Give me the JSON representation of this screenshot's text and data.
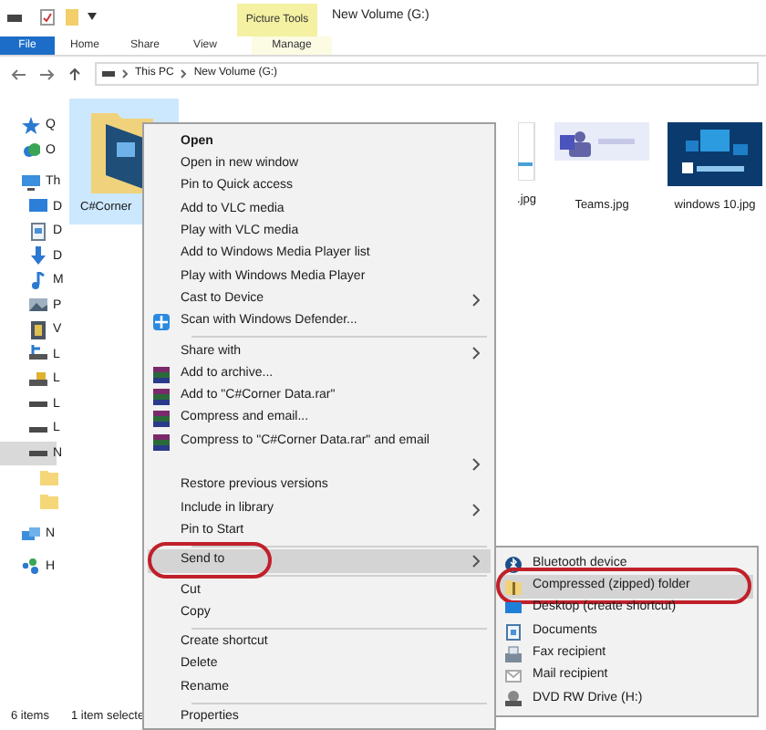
{
  "window": {
    "title": "New Volume (G:)",
    "context_tab": "Picture Tools"
  },
  "ribbon_tabs": [
    {
      "label": "File",
      "kind": "file"
    },
    {
      "label": "Home",
      "kind": "tab"
    },
    {
      "label": "Share",
      "kind": "tab"
    },
    {
      "label": "View",
      "kind": "tab"
    },
    {
      "label": "Manage",
      "kind": "context"
    }
  ],
  "address_bar": {
    "path": [
      "This PC",
      "New Volume (G:)"
    ]
  },
  "nav_pane": [
    {
      "label": "Q",
      "selected": false
    },
    {
      "label": "O",
      "selected": false
    },
    {
      "label": "Th",
      "selected": false,
      "children": [
        {
          "label": "D",
          "selected": false
        },
        {
          "label": "D",
          "selected": false
        },
        {
          "label": "D",
          "selected": false
        },
        {
          "label": "M",
          "selected": false
        },
        {
          "label": "P",
          "selected": false
        },
        {
          "label": "V",
          "selected": false
        },
        {
          "label": "L",
          "selected": false
        },
        {
          "label": "L",
          "selected": false
        },
        {
          "label": "L",
          "selected": false
        },
        {
          "label": "L",
          "selected": false
        },
        {
          "label": "N",
          "selected": true,
          "children": [
            {
              "selected": false
            },
            {
              "selected": false
            }
          ]
        }
      ]
    },
    {
      "label": "N",
      "selected": false
    },
    {
      "label": "H",
      "selected": false
    }
  ],
  "files": [
    {
      "name": "C#Corner",
      "kind": "folder",
      "selected": true
    },
    {
      "name": ".jpg",
      "kind": "partial",
      "selected": false
    },
    {
      "name": "Teams.jpg",
      "kind": "picture",
      "selected": false
    },
    {
      "name": "windows 10.jpg",
      "kind": "picture",
      "selected": false
    }
  ],
  "context_menu": [
    {
      "kind": "plain",
      "label": "Open",
      "bold": true,
      "selected": false
    },
    {
      "kind": "plain",
      "label": "Open in new window",
      "selected": false
    },
    {
      "kind": "plain",
      "label": "Pin to Quick access",
      "selected": false
    },
    {
      "kind": "plain",
      "label": "Add to VLC media",
      "selected": false
    },
    {
      "kind": "plain",
      "label": "Play with VLC media",
      "selected": false
    },
    {
      "kind": "plain",
      "label": "Add to Windows Media Player list",
      "selected": false
    },
    {
      "kind": "plain",
      "label": "Play with Windows Media Player",
      "selected": false
    },
    {
      "kind": "plain",
      "label": "Cast to Device",
      "submenu": true,
      "selected": false
    },
    {
      "kind": "scan",
      "label": "Scan with Windows Defender...",
      "selected": false
    },
    {
      "kind": "separator"
    },
    {
      "kind": "plain",
      "label": "Share with",
      "submenu": true,
      "selected": false
    },
    {
      "kind": "archive",
      "label": "Add to archive...",
      "selected": false
    },
    {
      "kind": "archive",
      "label": "Add to \"C#Corner Data.rar\"",
      "selected": false
    },
    {
      "kind": "archive",
      "label": "Compress and email...",
      "selected": false
    },
    {
      "kind": "archive",
      "label": "Compress to \"C#Corner Data.rar\" and email",
      "selected": false
    },
    {
      "kind": "plain",
      "submenu": true,
      "selected": false
    },
    {
      "kind": "plain",
      "label": "Restore previous versions",
      "selected": false
    },
    {
      "kind": "plain",
      "label": "Include in library",
      "submenu": true,
      "selected": false
    },
    {
      "kind": "plain",
      "label": "Pin to Start",
      "selected": false
    },
    {
      "kind": "separator"
    },
    {
      "kind": "plain",
      "label": "Send to",
      "submenu": true,
      "selected": true,
      "circled": true
    },
    {
      "kind": "separator"
    },
    {
      "kind": "plain",
      "label": "Cut",
      "selected": false
    },
    {
      "kind": "plain",
      "label": "Copy",
      "selected": false
    },
    {
      "kind": "separator"
    },
    {
      "kind": "plain",
      "label": "Create shortcut",
      "selected": false
    },
    {
      "kind": "plain",
      "label": "Delete",
      "selected": false
    },
    {
      "kind": "plain",
      "label": "Rename",
      "selected": false
    },
    {
      "kind": "separator"
    },
    {
      "kind": "plain",
      "label": "Properties",
      "selected": false
    }
  ],
  "send_to_menu": [
    {
      "label": "Bluetooth device",
      "selected": false,
      "circled": false
    },
    {
      "label": "Compressed (zipped) folder",
      "selected": true,
      "circled": true
    },
    {
      "label": "Desktop (create shortcut)",
      "selected": false,
      "circled": false
    },
    {
      "label": "Documents",
      "selected": false,
      "circled": false
    },
    {
      "label": "Fax recipient",
      "selected": false,
      "circled": false
    },
    {
      "label": "Mail recipient",
      "selected": false,
      "circled": false
    },
    {
      "label": "DVD RW Drive (H:)",
      "selected": false,
      "circled": false
    }
  ],
  "status_bar": {
    "item_count": "6 items",
    "selection": "1 item selecte"
  }
}
